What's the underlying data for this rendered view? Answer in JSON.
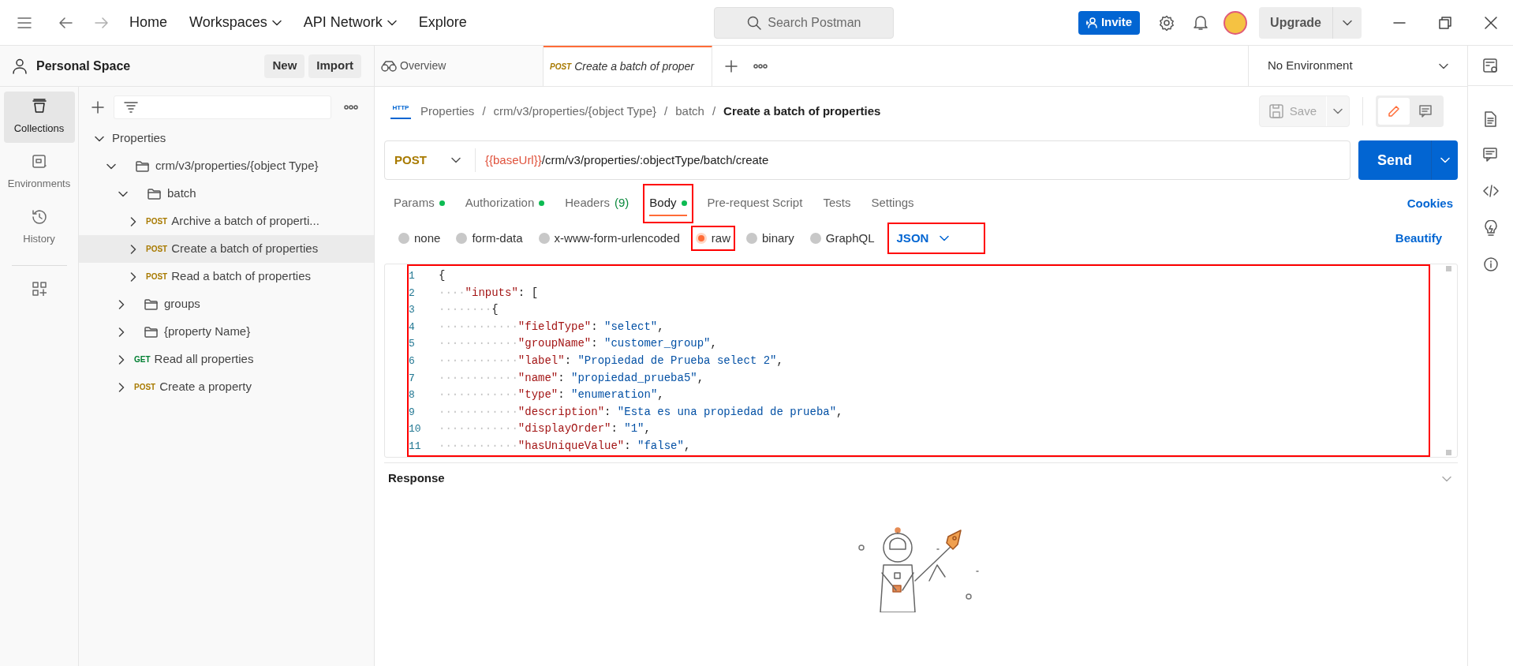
{
  "top_bar": {
    "nav": [
      {
        "label": "Home",
        "dropdown": false
      },
      {
        "label": "Workspaces",
        "dropdown": true
      },
      {
        "label": "API Network",
        "dropdown": true
      },
      {
        "label": "Explore",
        "dropdown": false
      }
    ],
    "search_placeholder": "Search Postman",
    "invite": "Invite",
    "upgrade": "Upgrade"
  },
  "workspace": {
    "name": "Personal Space",
    "buttons": [
      "New",
      "Import"
    ]
  },
  "sidebar": {
    "items": [
      {
        "label": "Collections",
        "selected": true
      },
      {
        "label": "Environments",
        "selected": false
      },
      {
        "label": "History",
        "selected": false
      }
    ]
  },
  "tree": [
    {
      "kind": "collection",
      "label": "Properties",
      "expanded": true,
      "selected": false,
      "children": [
        {
          "kind": "folder",
          "label": "crm/v3/properties/{object Type}",
          "expanded": true,
          "selected": false,
          "children": [
            {
              "kind": "folder",
              "label": "batch",
              "expanded": true,
              "selected": false,
              "children": [
                {
                  "kind": "request",
                  "method": "POST",
                  "color": "#a87a00",
                  "label": "Archive a batch of properti...",
                  "expanded": false,
                  "selected": false
                },
                {
                  "kind": "request",
                  "method": "POST",
                  "color": "#a87a00",
                  "label": "Create a batch of properties",
                  "expanded": false,
                  "selected": true
                },
                {
                  "kind": "request",
                  "method": "POST",
                  "color": "#a87a00",
                  "label": "Read a batch of properties",
                  "expanded": false,
                  "selected": false
                }
              ]
            },
            {
              "kind": "folder",
              "label": "groups",
              "expanded": false,
              "selected": false
            },
            {
              "kind": "folder",
              "label": "{property Name}",
              "expanded": false,
              "selected": false
            },
            {
              "kind": "request",
              "method": "GET",
              "color": "#007f31",
              "label": "Read all properties",
              "expanded": false,
              "selected": false
            },
            {
              "kind": "request",
              "method": "POST",
              "color": "#a87a00",
              "label": "Create a property",
              "expanded": false,
              "selected": false
            }
          ]
        }
      ]
    }
  ],
  "tabs": [
    {
      "kind": "overview",
      "label": "Overview",
      "selected": false
    },
    {
      "kind": "request",
      "method": "POST",
      "label": "Create a batch of proper",
      "selected": true
    }
  ],
  "environment": "No Environment",
  "request": {
    "protocol": "HTTP",
    "breadcrumb": [
      {
        "label": "Properties",
        "separator": "/"
      },
      {
        "label": "crm/v3/properties/{object Type}",
        "separator": "/"
      },
      {
        "label": "batch",
        "separator": "/"
      }
    ],
    "title": "Create a batch of properties",
    "save": {
      "label": "Save",
      "disabled": true
    },
    "method": "POST",
    "url_variable": "{{baseUrl}}",
    "url_path": "/crm/v3/properties/:objectType/batch/create",
    "send": "Send"
  },
  "request_tabs": [
    {
      "label": "Params",
      "dot": true,
      "selected": false,
      "highlighted": false
    },
    {
      "label": "Authorization",
      "dot": true,
      "selected": false,
      "highlighted": false
    },
    {
      "label": "Headers",
      "count": "(9)",
      "dot": false,
      "selected": false,
      "highlighted": false
    },
    {
      "label": "Body",
      "dot": true,
      "selected": true,
      "highlighted": true
    },
    {
      "label": "Pre-request Script",
      "dot": false,
      "selected": false,
      "highlighted": false
    },
    {
      "label": "Tests",
      "dot": false,
      "selected": false,
      "highlighted": false
    },
    {
      "label": "Settings",
      "dot": false,
      "selected": false,
      "highlighted": false
    }
  ],
  "cookies": "Cookies",
  "body_types": [
    {
      "label": "none",
      "selected": false,
      "highlighted": false
    },
    {
      "label": "form-data",
      "selected": false,
      "highlighted": false
    },
    {
      "label": "x-www-form-urlencoded",
      "selected": false,
      "highlighted": false
    },
    {
      "label": "raw",
      "selected": true,
      "highlighted": true
    },
    {
      "label": "binary",
      "selected": false,
      "highlighted": false
    },
    {
      "label": "GraphQL",
      "selected": false,
      "highlighted": false
    }
  ],
  "language": {
    "label": "JSON",
    "highlighted": true
  },
  "beautify": "Beautify",
  "editor": {
    "highlighted": true,
    "lines": [
      {
        "number": "1",
        "tokens": [
          {
            "kind": "punct",
            "text": "{"
          }
        ]
      },
      {
        "number": "2",
        "indent": "····",
        "tokens": [
          {
            "kind": "key",
            "text": "\"inputs\""
          },
          {
            "kind": "punct",
            "text": ": ["
          }
        ]
      },
      {
        "number": "3",
        "indent": "········",
        "tokens": [
          {
            "kind": "punct",
            "text": "{"
          }
        ]
      },
      {
        "number": "4",
        "indent": "············",
        "tokens": [
          {
            "kind": "key",
            "text": "\"fieldType\""
          },
          {
            "kind": "punct",
            "text": ": "
          },
          {
            "kind": "string",
            "text": "\"select\""
          },
          {
            "kind": "punct",
            "text": ","
          }
        ]
      },
      {
        "number": "5",
        "indent": "············",
        "tokens": [
          {
            "kind": "key",
            "text": "\"groupName\""
          },
          {
            "kind": "punct",
            "text": ": "
          },
          {
            "kind": "string",
            "text": "\"customer_group\""
          },
          {
            "kind": "punct",
            "text": ","
          }
        ]
      },
      {
        "number": "6",
        "indent": "············",
        "tokens": [
          {
            "kind": "key",
            "text": "\"label\""
          },
          {
            "kind": "punct",
            "text": ": "
          },
          {
            "kind": "string",
            "text": "\"Propiedad de Prueba select 2\""
          },
          {
            "kind": "punct",
            "text": ","
          }
        ]
      },
      {
        "number": "7",
        "indent": "············",
        "tokens": [
          {
            "kind": "key",
            "text": "\"name\""
          },
          {
            "kind": "punct",
            "text": ": "
          },
          {
            "kind": "string",
            "text": "\"propiedad_prueba5\""
          },
          {
            "kind": "punct",
            "text": ","
          }
        ]
      },
      {
        "number": "8",
        "indent": "············",
        "tokens": [
          {
            "kind": "key",
            "text": "\"type\""
          },
          {
            "kind": "punct",
            "text": ": "
          },
          {
            "kind": "string",
            "text": "\"enumeration\""
          },
          {
            "kind": "punct",
            "text": ","
          }
        ]
      },
      {
        "number": "9",
        "indent": "············",
        "tokens": [
          {
            "kind": "key",
            "text": "\"description\""
          },
          {
            "kind": "punct",
            "text": ": "
          },
          {
            "kind": "string",
            "text": "\"Esta es una propiedad de prueba\""
          },
          {
            "kind": "punct",
            "text": ","
          }
        ]
      },
      {
        "number": "10",
        "indent": "············",
        "tokens": [
          {
            "kind": "key",
            "text": "\"displayOrder\""
          },
          {
            "kind": "punct",
            "text": ": "
          },
          {
            "kind": "string",
            "text": "\"1\""
          },
          {
            "kind": "punct",
            "text": ","
          }
        ]
      },
      {
        "number": "11",
        "indent": "············",
        "tokens": [
          {
            "kind": "key",
            "text": "\"hasUniqueValue\""
          },
          {
            "kind": "punct",
            "text": ": "
          },
          {
            "kind": "string",
            "text": "\"false\""
          },
          {
            "kind": "punct",
            "text": ","
          }
        ]
      }
    ]
  },
  "response": {
    "title": "Response"
  }
}
